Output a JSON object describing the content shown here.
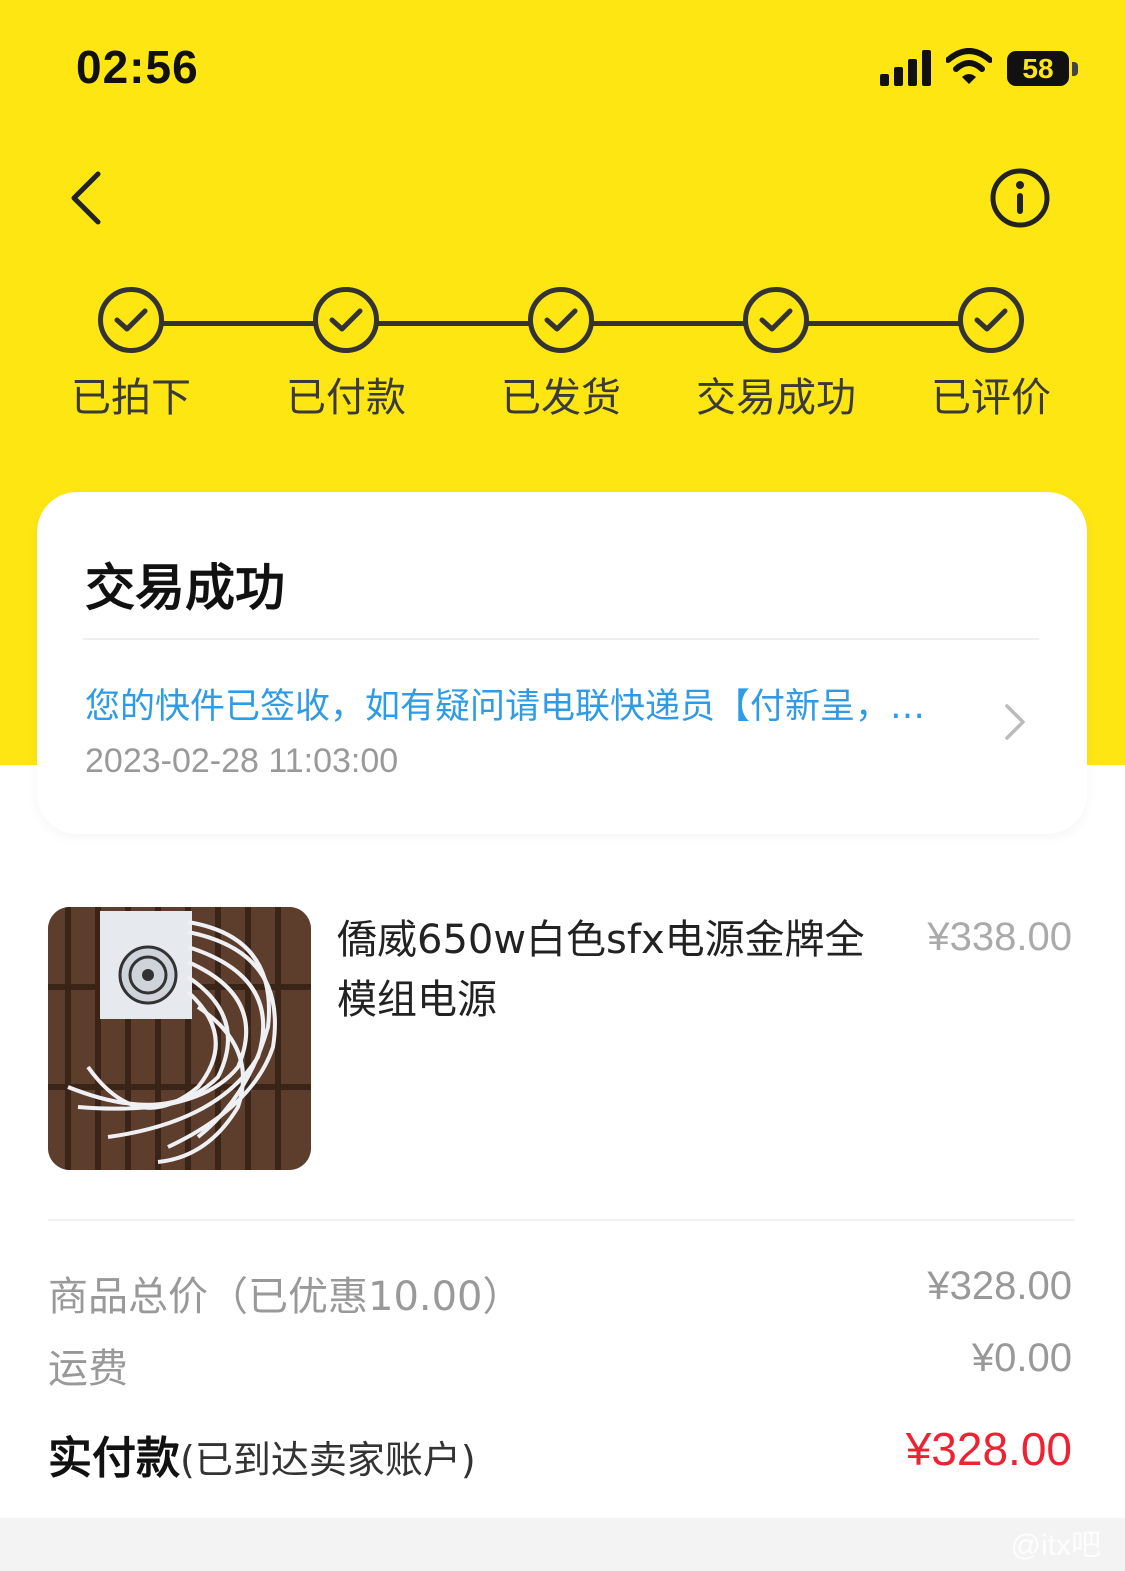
{
  "status_bar": {
    "time": "02:56",
    "battery": "58",
    "icons": [
      "signal-icon",
      "wifi-icon",
      "battery-icon"
    ]
  },
  "nav": {
    "back_icon": "chevron-left-icon",
    "info_icon": "info-icon"
  },
  "steps": [
    {
      "label": "已拍下",
      "done": true
    },
    {
      "label": "已付款",
      "done": true
    },
    {
      "label": "已发货",
      "done": true
    },
    {
      "label": "交易成功",
      "done": true
    },
    {
      "label": "已评价",
      "done": true
    }
  ],
  "status_card": {
    "title": "交易成功",
    "logistics_message": "您的快件已签收，如有疑问请电联快递员【付新呈，…",
    "logistics_time": "2023-02-28 11:03:00"
  },
  "product": {
    "title": "僑威650w白色sfx电源金牌全模组电源",
    "price": "¥338.00"
  },
  "summary": {
    "goods_total_label": "商品总价（已优惠10.00）",
    "goods_total_value": "¥328.00",
    "shipping_label": "运费",
    "shipping_value": "¥0.00",
    "paid_label": "实付款",
    "paid_note": "(已到达卖家账户)",
    "paid_value": "¥328.00"
  },
  "watermark": "@itx吧",
  "colors": {
    "header_yellow": "#fde612",
    "link_blue": "#2e9be6",
    "price_red": "#ee2233"
  }
}
